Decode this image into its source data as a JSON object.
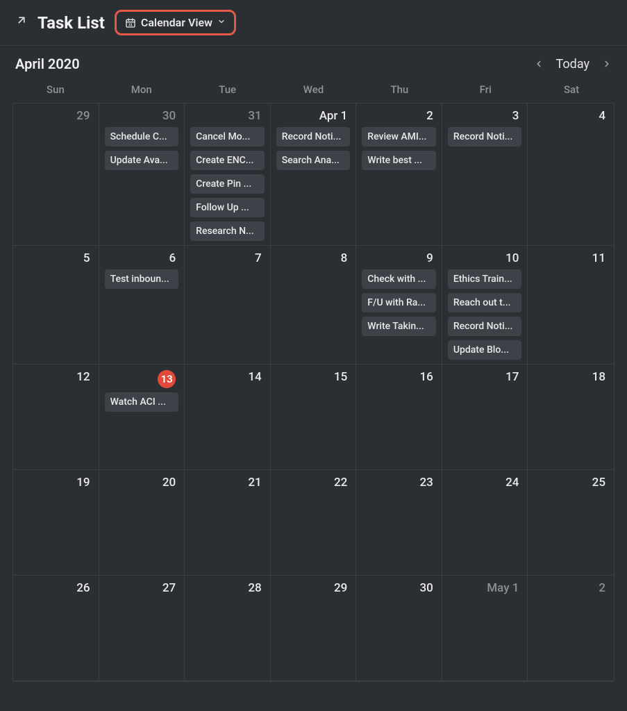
{
  "header": {
    "title": "Task List",
    "view_label": "Calendar View"
  },
  "subheader": {
    "month_label": "April 2020",
    "today_label": "Today"
  },
  "days_of_week": [
    "Sun",
    "Mon",
    "Tue",
    "Wed",
    "Thu",
    "Fri",
    "Sat"
  ],
  "weeks": [
    [
      {
        "label": "29",
        "dim": true,
        "events": []
      },
      {
        "label": "30",
        "dim": true,
        "events": [
          "Schedule C...",
          "Update Ava..."
        ]
      },
      {
        "label": "31",
        "dim": true,
        "events": [
          "Cancel Mo...",
          "Create ENC...",
          "Create Pin ...",
          "Follow Up ...",
          "Research N..."
        ]
      },
      {
        "label": "Apr 1",
        "dim": false,
        "events": [
          "Record Noti...",
          "Search Ana..."
        ]
      },
      {
        "label": "2",
        "dim": false,
        "events": [
          "Review AMI...",
          "Write best ..."
        ]
      },
      {
        "label": "3",
        "dim": false,
        "events": [
          "Record Noti..."
        ]
      },
      {
        "label": "4",
        "dim": false,
        "events": []
      }
    ],
    [
      {
        "label": "5",
        "dim": false,
        "events": []
      },
      {
        "label": "6",
        "dim": false,
        "events": [
          "Test inboun..."
        ]
      },
      {
        "label": "7",
        "dim": false,
        "events": []
      },
      {
        "label": "8",
        "dim": false,
        "events": []
      },
      {
        "label": "9",
        "dim": false,
        "events": [
          "Check with ...",
          "F/U with Ra...",
          "Write Takin..."
        ]
      },
      {
        "label": "10",
        "dim": false,
        "events": [
          "Ethics Train...",
          "Reach out t...",
          "Record Noti...",
          "Update Blo..."
        ]
      },
      {
        "label": "11",
        "dim": false,
        "events": []
      }
    ],
    [
      {
        "label": "12",
        "dim": false,
        "events": []
      },
      {
        "label": "13",
        "dim": false,
        "today": true,
        "events": [
          "Watch ACI ..."
        ]
      },
      {
        "label": "14",
        "dim": false,
        "events": []
      },
      {
        "label": "15",
        "dim": false,
        "events": []
      },
      {
        "label": "16",
        "dim": false,
        "events": []
      },
      {
        "label": "17",
        "dim": false,
        "events": []
      },
      {
        "label": "18",
        "dim": false,
        "events": []
      }
    ],
    [
      {
        "label": "19",
        "dim": false,
        "events": []
      },
      {
        "label": "20",
        "dim": false,
        "events": []
      },
      {
        "label": "21",
        "dim": false,
        "events": []
      },
      {
        "label": "22",
        "dim": false,
        "events": []
      },
      {
        "label": "23",
        "dim": false,
        "events": []
      },
      {
        "label": "24",
        "dim": false,
        "events": []
      },
      {
        "label": "25",
        "dim": false,
        "events": []
      }
    ],
    [
      {
        "label": "26",
        "dim": false,
        "events": []
      },
      {
        "label": "27",
        "dim": false,
        "events": []
      },
      {
        "label": "28",
        "dim": false,
        "events": []
      },
      {
        "label": "29",
        "dim": false,
        "events": []
      },
      {
        "label": "30",
        "dim": false,
        "events": []
      },
      {
        "label": "May 1",
        "dim": true,
        "events": []
      },
      {
        "label": "2",
        "dim": true,
        "events": []
      }
    ]
  ]
}
